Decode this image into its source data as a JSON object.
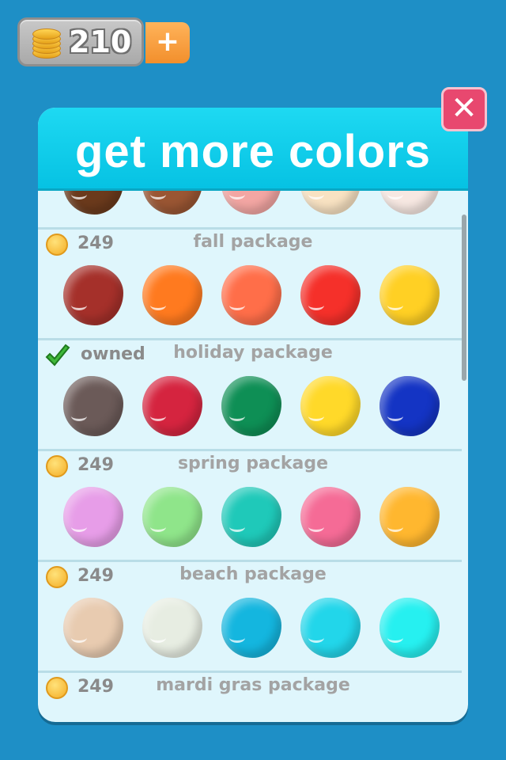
{
  "wallet": {
    "coins": "210",
    "plus_label": "+"
  },
  "dialog": {
    "title": "get more colors",
    "close_label": "✕",
    "top_partial_colors": [
      "#6b3a1c",
      "#9a5633",
      "#f3a6a3",
      "#f8e2c2",
      "#f7e8e2"
    ],
    "packages": [
      {
        "name": "fall package",
        "price": "249",
        "owned": false,
        "colors": [
          "#a5302a",
          "#ff7a1f",
          "#ff6e49",
          "#f5302a",
          "#ffd024"
        ]
      },
      {
        "name": "holiday package",
        "price": "",
        "owned": true,
        "owned_label": "owned",
        "colors": [
          "#6b5a58",
          "#d5243f",
          "#0e8f55",
          "#ffd929",
          "#1434c4"
        ]
      },
      {
        "name": "spring package",
        "price": "249",
        "owned": false,
        "colors": [
          "#e79de8",
          "#8fe58a",
          "#1fc9b9",
          "#f56b96",
          "#ffb72f"
        ]
      },
      {
        "name": "beach package",
        "price": "249",
        "owned": false,
        "colors": [
          "#e8cbb0",
          "#e7ede2",
          "#14b6df",
          "#22d6ea",
          "#26f0f0"
        ]
      },
      {
        "name": "mardi gras package",
        "price": "249",
        "owned": false,
        "colors": []
      }
    ]
  }
}
